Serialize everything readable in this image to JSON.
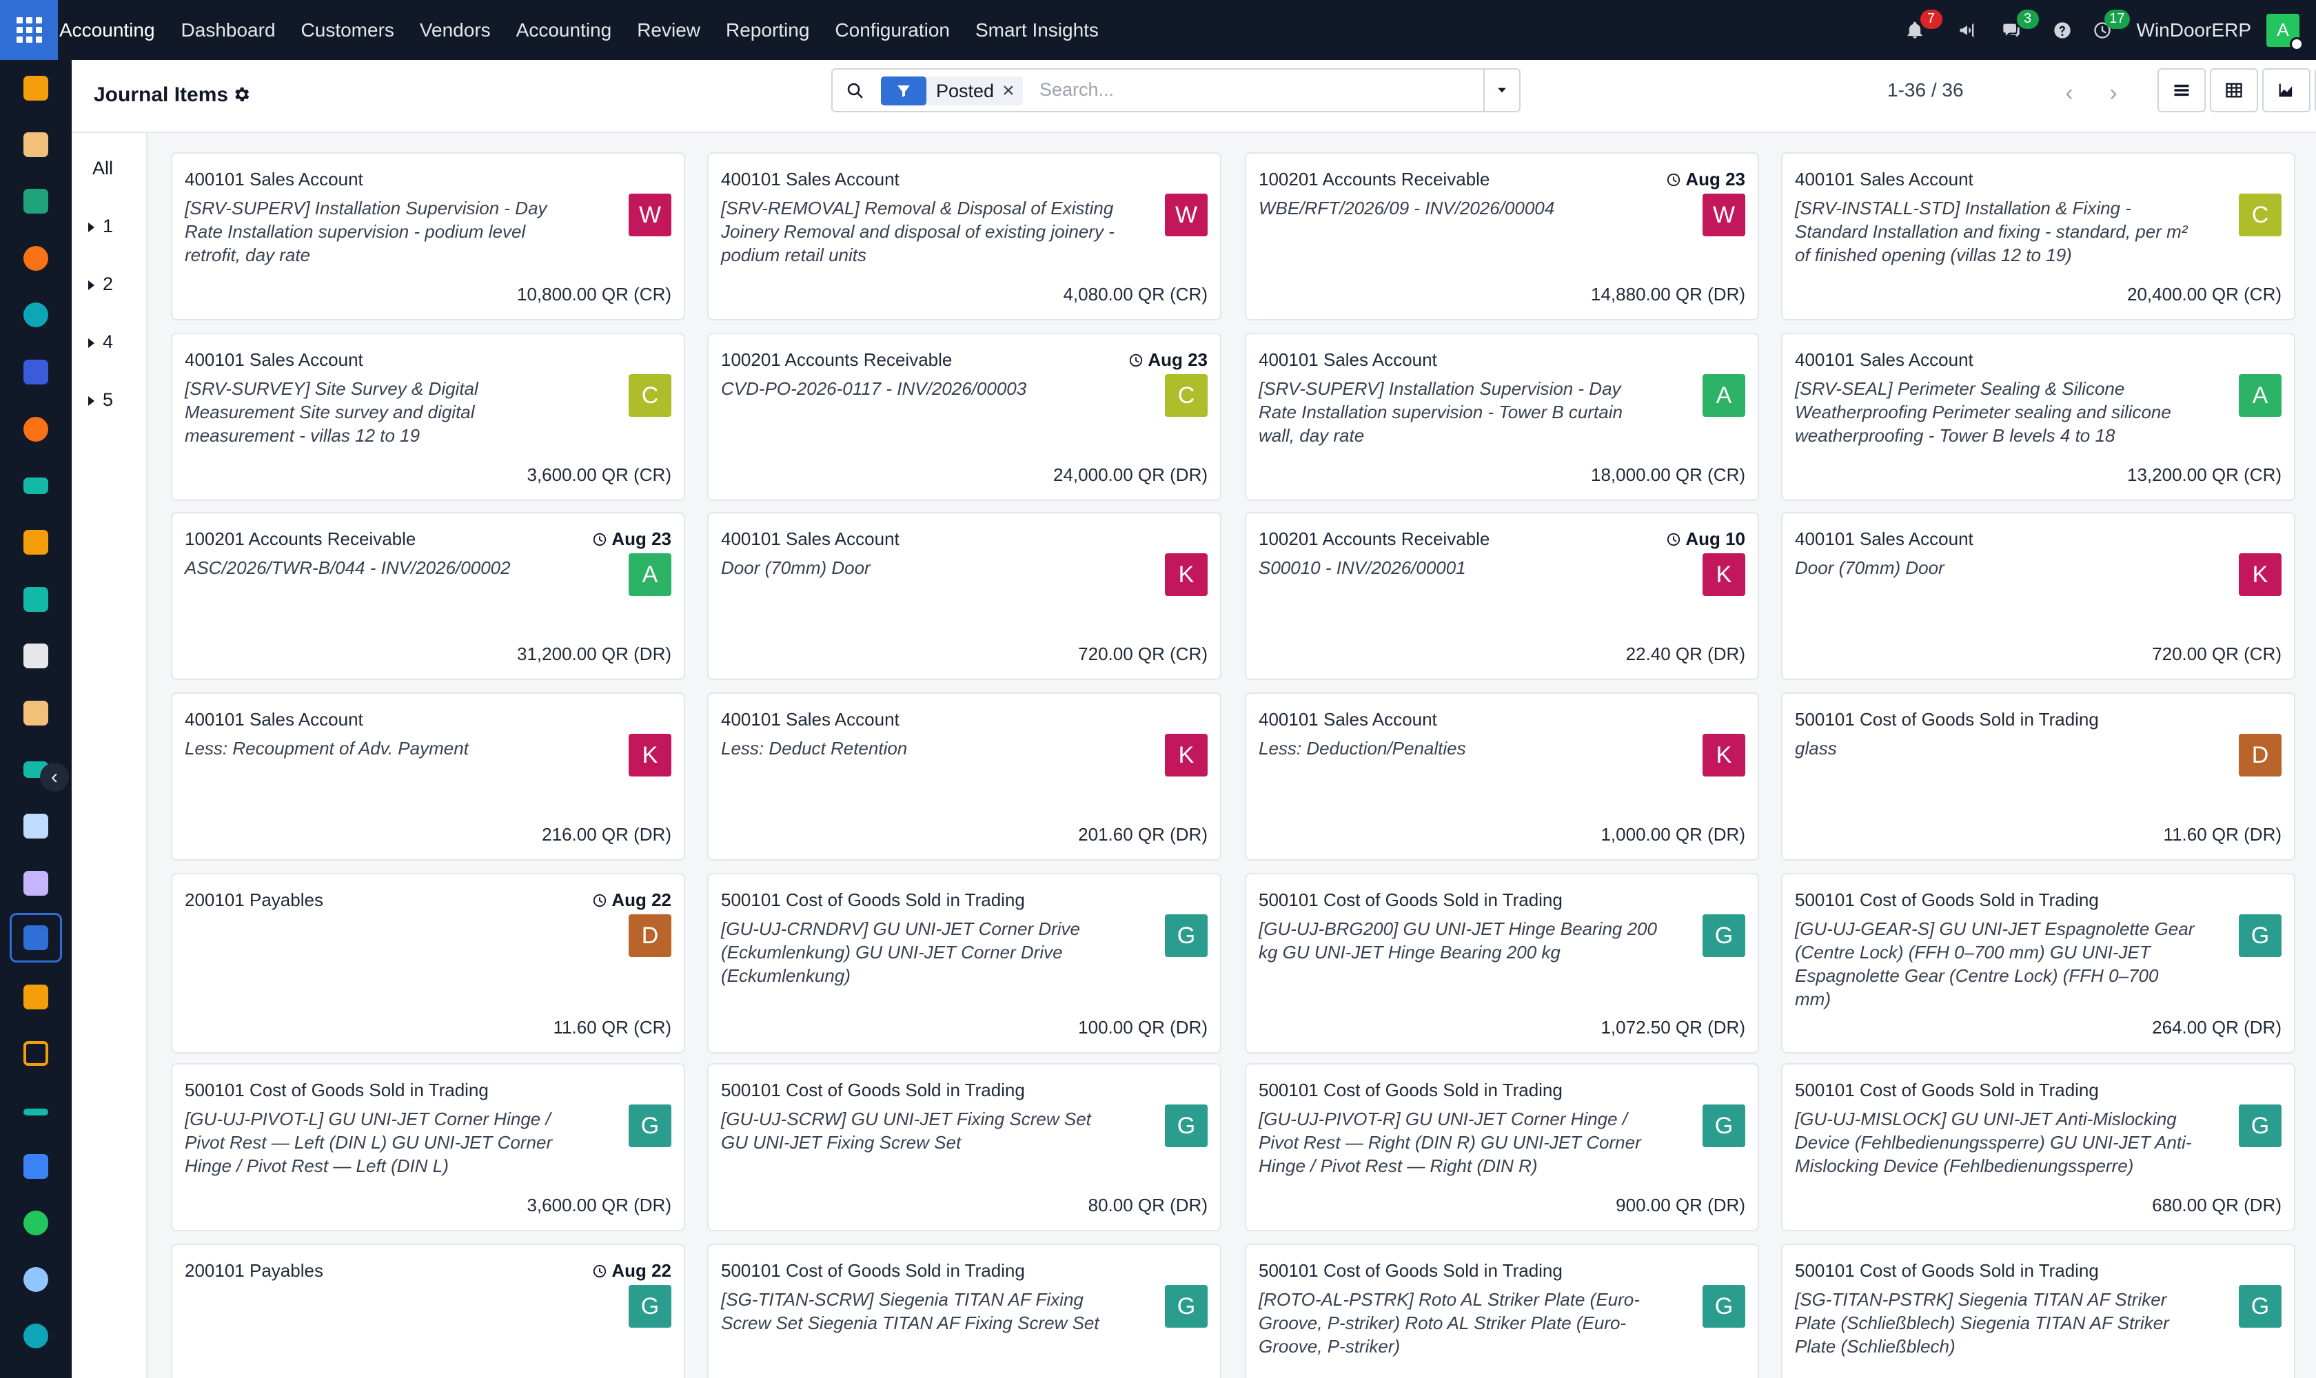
{
  "app": {
    "name": "Accounting",
    "menu": [
      "Dashboard",
      "Customers",
      "Vendors",
      "Accounting",
      "Review",
      "Reporting",
      "Configuration",
      "Smart Insights"
    ],
    "activity_count": "7",
    "messages_count": "3",
    "activity2_count": "17",
    "company": "WinDoorERP",
    "user_initial": "A"
  },
  "control": {
    "title": "Journal Items",
    "facet_label": "Posted",
    "search_placeholder": "Search...",
    "pager": "1-36 / 36"
  },
  "groups": {
    "all": "All",
    "items": [
      "1",
      "2",
      "4",
      "5"
    ]
  },
  "colors": {
    "accent": "#2f6fd6",
    "avatar_W": "#c2185b",
    "avatar_C": "#aebd2a",
    "avatar_A": "#2db365",
    "avatar_K": "#c2185b",
    "avatar_D": "#b8642a",
    "avatar_G": "#2b9d8f"
  },
  "cards": [
    {
      "account": "400101 Sales Account",
      "date": "",
      "desc": "[SRV-SUPERV] Installation Supervision - Day Rate Installation supervision - podium level retrofit, day rate",
      "avatar": "W",
      "amount": "10,800.00 QR (CR)"
    },
    {
      "account": "400101 Sales Account",
      "date": "",
      "desc": "[SRV-REMOVAL] Removal & Disposal of Existing Joinery Removal and disposal of existing joinery - podium retail units",
      "avatar": "W",
      "amount": "4,080.00 QR (CR)"
    },
    {
      "account": "100201 Accounts Receivable",
      "date": "Aug 23",
      "desc": "WBE/RFT/2026/09 - INV/2026/00004",
      "avatar": "W",
      "amount": "14,880.00 QR (DR)"
    },
    {
      "account": "400101 Sales Account",
      "date": "",
      "desc": "[SRV-INSTALL-STD] Installation & Fixing - Standard Installation and fixing - standard, per m² of finished opening (villas 12 to 19)",
      "avatar": "C",
      "amount": "20,400.00 QR (CR)"
    },
    {
      "account": "400101 Sales Account",
      "date": "",
      "desc": "[SRV-SURVEY] Site Survey & Digital Measurement Site survey and digital measurement - villas 12 to 19",
      "avatar": "C",
      "amount": "3,600.00 QR (CR)"
    },
    {
      "account": "100201 Accounts Receivable",
      "date": "Aug 23",
      "desc": "CVD-PO-2026-0117 - INV/2026/00003",
      "avatar": "C",
      "amount": "24,000.00 QR (DR)"
    },
    {
      "account": "400101 Sales Account",
      "date": "",
      "desc": "[SRV-SUPERV] Installation Supervision - Day Rate Installation supervision - Tower B curtain wall, day rate",
      "avatar": "A",
      "amount": "18,000.00 QR (CR)"
    },
    {
      "account": "400101 Sales Account",
      "date": "",
      "desc": "[SRV-SEAL] Perimeter Sealing & Silicone Weatherproofing Perimeter sealing and silicone weatherproofing - Tower B levels 4 to 18",
      "avatar": "A",
      "amount": "13,200.00 QR (CR)"
    },
    {
      "account": "100201 Accounts Receivable",
      "date": "Aug 23",
      "desc": "ASC/2026/TWR-B/044 - INV/2026/00002",
      "avatar": "A",
      "amount": "31,200.00 QR (DR)"
    },
    {
      "account": "400101 Sales Account",
      "date": "",
      "desc": "Door (70mm) Door",
      "avatar": "K",
      "amount": "720.00 QR (CR)"
    },
    {
      "account": "100201 Accounts Receivable",
      "date": "Aug 10",
      "desc": "S00010 - INV/2026/00001",
      "avatar": "K",
      "amount": "22.40 QR (DR)"
    },
    {
      "account": "400101 Sales Account",
      "date": "",
      "desc": "Door (70mm) Door",
      "avatar": "K",
      "amount": "720.00 QR (CR)"
    },
    {
      "account": "400101 Sales Account",
      "date": "",
      "desc": "Less: Recoupment of Adv. Payment",
      "avatar": "K",
      "amount": "216.00 QR (DR)"
    },
    {
      "account": "400101 Sales Account",
      "date": "",
      "desc": "Less: Deduct Retention",
      "avatar": "K",
      "amount": "201.60 QR (DR)"
    },
    {
      "account": "400101 Sales Account",
      "date": "",
      "desc": "Less: Deduction/Penalties",
      "avatar": "K",
      "amount": "1,000.00 QR (DR)"
    },
    {
      "account": "500101 Cost of Goods Sold in Trading",
      "date": "",
      "desc": "glass",
      "avatar": "D",
      "amount": "11.60 QR (DR)"
    },
    {
      "account": "200101 Payables",
      "date": "Aug 22",
      "desc": "",
      "avatar": "D",
      "amount": "11.60 QR (CR)"
    },
    {
      "account": "500101 Cost of Goods Sold in Trading",
      "date": "",
      "desc": "[GU-UJ-CRNDRV] GU UNI-JET Corner Drive (Eckumlenkung) GU UNI-JET Corner Drive (Eckumlenkung)",
      "avatar": "G",
      "amount": "100.00 QR (DR)"
    },
    {
      "account": "500101 Cost of Goods Sold in Trading",
      "date": "",
      "desc": "[GU-UJ-BRG200] GU UNI-JET Hinge Bearing 200 kg GU UNI-JET Hinge Bearing 200 kg",
      "avatar": "G",
      "amount": "1,072.50 QR (DR)"
    },
    {
      "account": "500101 Cost of Goods Sold in Trading",
      "date": "",
      "desc": "[GU-UJ-GEAR-S] GU UNI-JET Espagnolette Gear (Centre Lock) (FFH 0–700 mm) GU UNI-JET Espagnolette Gear (Centre Lock) (FFH 0–700 mm)",
      "avatar": "G",
      "amount": "264.00 QR (DR)"
    },
    {
      "account": "500101 Cost of Goods Sold in Trading",
      "date": "",
      "desc": "[GU-UJ-PIVOT-L] GU UNI-JET Corner Hinge / Pivot Rest — Left (DIN L) GU UNI-JET Corner Hinge / Pivot Rest — Left (DIN L)",
      "avatar": "G",
      "amount": "3,600.00 QR (DR)"
    },
    {
      "account": "500101 Cost of Goods Sold in Trading",
      "date": "",
      "desc": "[GU-UJ-SCRW] GU UNI-JET Fixing Screw Set GU UNI-JET Fixing Screw Set",
      "avatar": "G",
      "amount": "80.00 QR (DR)"
    },
    {
      "account": "500101 Cost of Goods Sold in Trading",
      "date": "",
      "desc": "[GU-UJ-PIVOT-R] GU UNI-JET Corner Hinge / Pivot Rest — Right (DIN R) GU UNI-JET Corner Hinge / Pivot Rest — Right (DIN R)",
      "avatar": "G",
      "amount": "900.00 QR (DR)"
    },
    {
      "account": "500101 Cost of Goods Sold in Trading",
      "date": "",
      "desc": "[GU-UJ-MISLOCK] GU UNI-JET Anti-Mislocking Device (Fehlbedienungssperre) GU UNI-JET Anti-Mislocking Device (Fehlbedienungssperre)",
      "avatar": "G",
      "amount": "680.00 QR (DR)"
    },
    {
      "account": "200101 Payables",
      "date": "Aug 22",
      "desc": "",
      "avatar": "G",
      "amount": ""
    },
    {
      "account": "500101 Cost of Goods Sold in Trading",
      "date": "",
      "desc": "[SG-TITAN-SCRW] Siegenia TITAN AF Fixing Screw Set Siegenia TITAN AF Fixing Screw Set",
      "avatar": "G",
      "amount": ""
    },
    {
      "account": "500101 Cost of Goods Sold in Trading",
      "date": "",
      "desc": "[ROTO-AL-PSTRK] Roto AL Striker Plate (Euro-Groove, P-striker) Roto AL Striker Plate (Euro-Groove, P-striker)",
      "avatar": "G",
      "amount": ""
    },
    {
      "account": "500101 Cost of Goods Sold in Trading",
      "date": "",
      "desc": "[SG-TITAN-PSTRK] Siegenia TITAN AF Striker Plate (Schließblech) Siegenia TITAN AF Striker Plate (Schließblech)",
      "avatar": "G",
      "amount": ""
    }
  ]
}
